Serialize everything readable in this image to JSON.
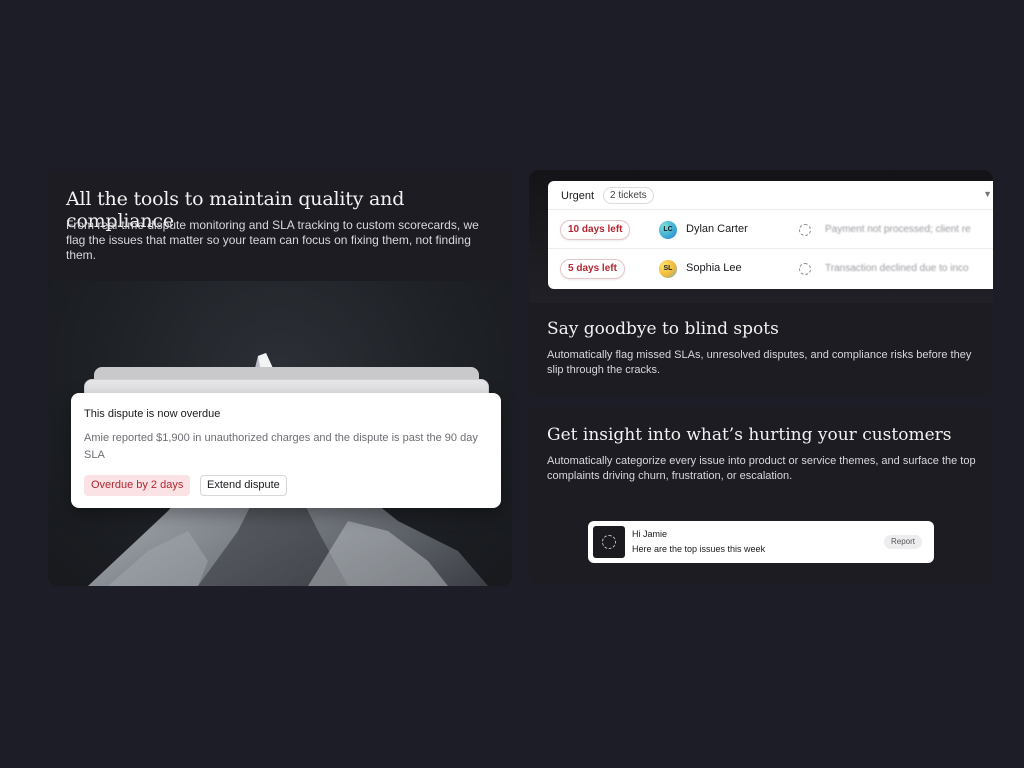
{
  "left_card": {
    "title": "All the tools to maintain quality and compliance",
    "description": "From real-time dispute monitoring and SLA tracking to custom scorecards, we flag the issues that matter so your team can focus on fixing them, not finding them.",
    "alert": {
      "title": "This dispute is now overdue",
      "body": "Amie reported $1,900 in unauthorized charges and the dispute  is past the 90 day SLA",
      "badge": "Overdue by 2 days",
      "action": "Extend dispute"
    }
  },
  "top_right_card": {
    "panel": {
      "heading": "Urgent",
      "count": "2 tickets",
      "rows": [
        {
          "days": "10 days left",
          "initials": "LC",
          "name": "Dylan Carter",
          "message": "Payment not processed; client re"
        },
        {
          "days": "5 days left",
          "initials": "SL",
          "name": "Sophia Lee",
          "message": "Transaction declined due to inco"
        }
      ]
    },
    "title": "Say goodbye to blind spots",
    "description": "Automatically flag missed SLAs, unresolved disputes, and compliance risks before they slip through the cracks."
  },
  "bottom_right_card": {
    "title": "Get insight into what’s hurting your customers",
    "description": "Automatically categorize every issue into product or service themes, and surface the top complaints driving churn, frustration, or escalation.",
    "notice": {
      "greeting": "Hi Jamie",
      "message": "Here are the top issues this week",
      "action": "Report"
    }
  },
  "colors": {
    "background": "#1d1d27",
    "card": "#1c1c22",
    "alert_red": "#b3262f",
    "alert_red_bg": "#fbe3e5"
  }
}
